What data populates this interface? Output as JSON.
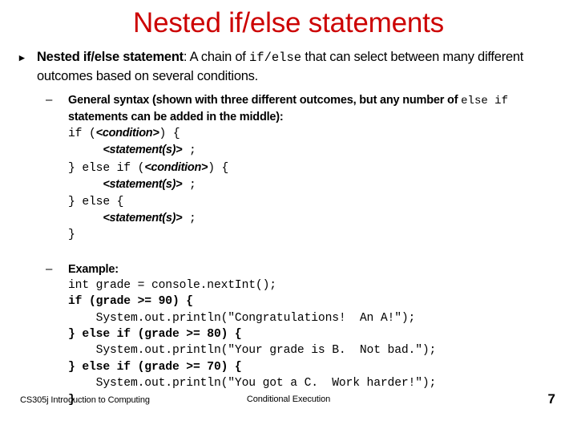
{
  "slide": {
    "title": "Nested if/else statements",
    "title_color": "#CC0000",
    "bullet1": {
      "marker": "▸",
      "term": "Nested if/else statement",
      "text_a": ": A chain of ",
      "code_a": "if/else",
      "text_b": " that can select between many different outcomes based on several conditions."
    },
    "bullet2": {
      "marker": "–",
      "text_a": "General syntax (shown with three different outcomes, but any number of ",
      "code_a": "else if",
      "text_b": " statements can be added in the middle):"
    },
    "syntax_code": {
      "l1_a": "if (",
      "l1_ph": "<condition>",
      "l1_b": ") {",
      "l2_indent": "     ",
      "l2_ph": "<statement(s)>",
      "l2_b": " ;",
      "l3_a": "} else if (",
      "l3_ph": "<condition>",
      "l3_b": ") {",
      "l4_indent": "     ",
      "l4_ph": "<statement(s)>",
      "l4_b": " ;",
      "l5_a": "} else {",
      "l6_indent": "     ",
      "l6_ph": "<statement(s)>",
      "l6_b": " ;",
      "l7_a": "}"
    },
    "bullet3": {
      "marker": "–",
      "text": "Example:"
    },
    "example_code": {
      "line1": "int grade = console.nextInt();",
      "line2": "if (grade >= 90) {",
      "line3": "    System.out.println(\"Congratulations!  An A!\");",
      "line4": "} else if (grade >= 80) {",
      "line5": "    System.out.println(\"Your grade is B.  Not bad.\");",
      "line6": "} else if (grade >= 70) {",
      "line7": "    System.out.println(\"You got a C.  Work harder!\");",
      "line8": "}"
    }
  },
  "footer": {
    "left": "CS305j Introduction to Computing",
    "center": "Conditional Execution",
    "page": "7"
  }
}
